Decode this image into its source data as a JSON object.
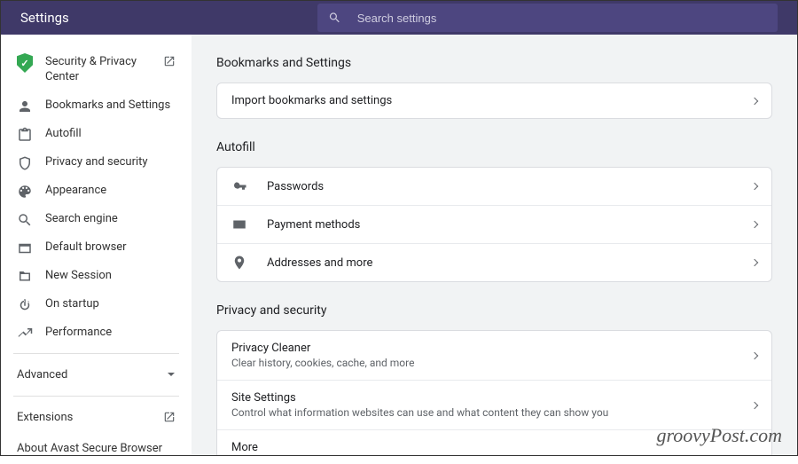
{
  "header": {
    "title": "Settings",
    "search_placeholder": "Search settings"
  },
  "sidebar": {
    "items": [
      {
        "label": "Security & Privacy Center",
        "icon": "shield-check"
      },
      {
        "label": "Bookmarks and Settings",
        "icon": "person"
      },
      {
        "label": "Autofill",
        "icon": "clipboard"
      },
      {
        "label": "Privacy and security",
        "icon": "shield"
      },
      {
        "label": "Appearance",
        "icon": "palette"
      },
      {
        "label": "Search engine",
        "icon": "search"
      },
      {
        "label": "Default browser",
        "icon": "browser"
      },
      {
        "label": "New Session",
        "icon": "folder"
      },
      {
        "label": "On startup",
        "icon": "power"
      },
      {
        "label": "Performance",
        "icon": "trend"
      }
    ],
    "advanced": "Advanced",
    "extensions": "Extensions",
    "about": "About Avast Secure Browser"
  },
  "sections": {
    "bookmarks": {
      "title": "Bookmarks and Settings",
      "rows": [
        {
          "title": "Import bookmarks and settings"
        }
      ]
    },
    "autofill": {
      "title": "Autofill",
      "rows": [
        {
          "title": "Passwords",
          "icon": "key"
        },
        {
          "title": "Payment methods",
          "icon": "card"
        },
        {
          "title": "Addresses and more",
          "icon": "pin"
        }
      ]
    },
    "privacy": {
      "title": "Privacy and security",
      "rows": [
        {
          "title": "Privacy Cleaner",
          "sub": "Clear history, cookies, cache, and more"
        },
        {
          "title": "Site Settings",
          "sub": "Control what information websites can use and what content they can show you"
        },
        {
          "title": "More"
        }
      ]
    }
  },
  "watermark": "groovyPost.com"
}
